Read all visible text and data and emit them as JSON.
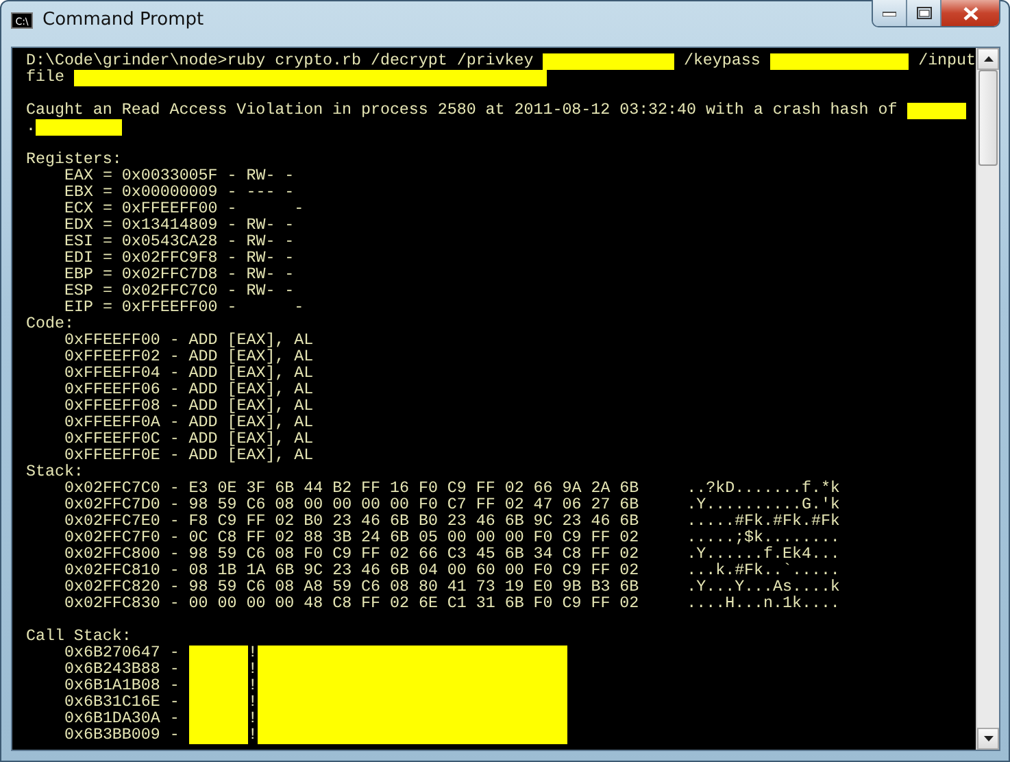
{
  "window": {
    "title": "Command Prompt",
    "icon_text": "C:\\"
  },
  "console": {
    "lines": [
      {
        "kind": "mixed",
        "parts": [
          {
            "kind": "text",
            "text": "D:\\Code\\grinder\\node>ruby crypto.rb /decrypt /privkey"
          },
          {
            "kind": "redaction"
          },
          {
            "kind": "text",
            "text": "/keypass"
          },
          {
            "kind": "redaction"
          },
          {
            "kind": "text",
            "text": "/input"
          }
        ]
      },
      {
        "kind": "mixed",
        "parts": [
          {
            "kind": "text",
            "text": "file"
          },
          {
            "kind": "redaction"
          }
        ]
      },
      {
        "kind": "blank"
      },
      {
        "kind": "mixed",
        "parts": [
          {
            "kind": "text",
            "text": "Caught an Read Access Violation in process 2580 at 2011-08-12 03:32:40 with a crash hash of"
          },
          {
            "kind": "redaction"
          }
        ]
      },
      {
        "kind": "mixed",
        "parts": [
          {
            "kind": "text",
            "text": "."
          },
          {
            "kind": "redaction"
          }
        ]
      },
      {
        "kind": "blank"
      },
      {
        "kind": "heading",
        "text": "Registers:"
      },
      {
        "kind": "item",
        "text": "EAX = 0x0033005F - RW- -"
      },
      {
        "kind": "item",
        "text": "EBX = 0x00000009 - --- -"
      },
      {
        "kind": "item",
        "text": "ECX = 0xFFEEFF00 -      -"
      },
      {
        "kind": "item",
        "text": "EDX = 0x13414809 - RW- -"
      },
      {
        "kind": "item",
        "text": "ESI = 0x0543CA28 - RW- -"
      },
      {
        "kind": "item",
        "text": "EDI = 0x02FFC9F8 - RW- -"
      },
      {
        "kind": "item",
        "text": "EBP = 0x02FFC7D8 - RW- -"
      },
      {
        "kind": "item",
        "text": "ESP = 0x02FFC7C0 - RW- -"
      },
      {
        "kind": "item",
        "text": "EIP = 0xFFEEFF00 -      -"
      },
      {
        "kind": "heading",
        "text": "Code:"
      },
      {
        "kind": "item",
        "text": "0xFFEEFF00 - ADD [EAX], AL"
      },
      {
        "kind": "item",
        "text": "0xFFEEFF02 - ADD [EAX], AL"
      },
      {
        "kind": "item",
        "text": "0xFFEEFF04 - ADD [EAX], AL"
      },
      {
        "kind": "item",
        "text": "0xFFEEFF06 - ADD [EAX], AL"
      },
      {
        "kind": "item",
        "text": "0xFFEEFF08 - ADD [EAX], AL"
      },
      {
        "kind": "item",
        "text": "0xFFEEFF0A - ADD [EAX], AL"
      },
      {
        "kind": "item",
        "text": "0xFFEEFF0C - ADD [EAX], AL"
      },
      {
        "kind": "item",
        "text": "0xFFEEFF0E - ADD [EAX], AL"
      },
      {
        "kind": "heading",
        "text": "Stack:"
      },
      {
        "kind": "dump",
        "bytes": "0x02FFC7C0 - E3 0E 3F 6B 44 B2 FF 16 F0 C9 FF 02 66 9A 2A 6B",
        "ascii": "..?kD.......f.*k"
      },
      {
        "kind": "dump",
        "bytes": "0x02FFC7D0 - 98 59 C6 08 00 00 00 00 F0 C7 FF 02 47 06 27 6B",
        "ascii": ".Y..........G.'k"
      },
      {
        "kind": "dump",
        "bytes": "0x02FFC7E0 - F8 C9 FF 02 B0 23 46 6B B0 23 46 6B 9C 23 46 6B",
        "ascii": ".....#Fk.#Fk.#Fk"
      },
      {
        "kind": "dump",
        "bytes": "0x02FFC7F0 - 0C C8 FF 02 88 3B 24 6B 05 00 00 00 F0 C9 FF 02",
        "ascii": ".....;$k........"
      },
      {
        "kind": "dump",
        "bytes": "0x02FFC800 - 98 59 C6 08 F0 C9 FF 02 66 C3 45 6B 34 C8 FF 02",
        "ascii": ".Y......f.Ek4..."
      },
      {
        "kind": "dump",
        "bytes": "0x02FFC810 - 08 1B 1A 6B 9C 23 46 6B 04 00 60 00 F0 C9 FF 02",
        "ascii": "...k.#Fk..`....."
      },
      {
        "kind": "dump",
        "bytes": "0x02FFC820 - 98 59 C6 08 A8 59 C6 08 80 41 73 19 E0 9B B3 6B",
        "ascii": ".Y...Y...As....k"
      },
      {
        "kind": "dump",
        "bytes": "0x02FFC830 - 00 00 00 00 48 C8 FF 02 6E C1 31 6B F0 C9 FF 02",
        "ascii": "....H...n.1k...."
      },
      {
        "kind": "blank"
      },
      {
        "kind": "heading",
        "text": "Call Stack:"
      },
      {
        "kind": "frame",
        "address": "0x6B270647 -",
        "separator": "!"
      },
      {
        "kind": "frame",
        "address": "0x6B243B88 -",
        "separator": "!"
      },
      {
        "kind": "frame",
        "address": "0x6B1A1B08 -",
        "separator": "!"
      },
      {
        "kind": "frame",
        "address": "0x6B31C16E -",
        "separator": "!"
      },
      {
        "kind": "frame",
        "address": "0x6B1DA30A -",
        "separator": "!"
      },
      {
        "kind": "frame",
        "address": "0x6B3BB009 -",
        "separator": "!"
      }
    ]
  }
}
